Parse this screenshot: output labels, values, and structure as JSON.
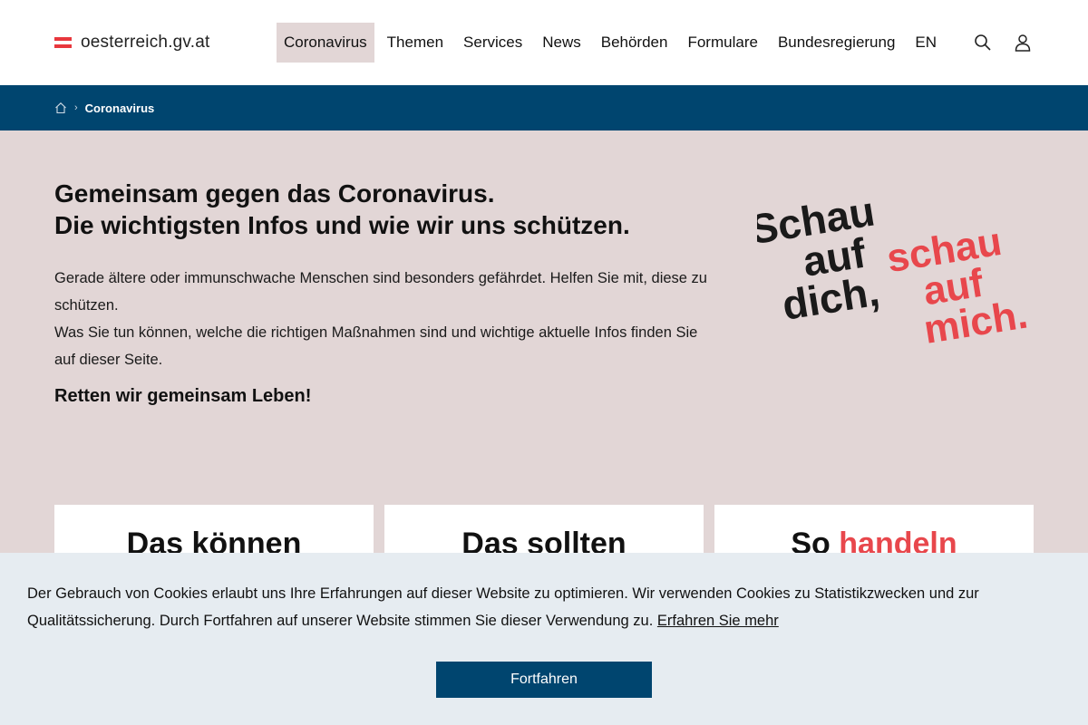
{
  "header": {
    "logo_text": "oesterreich.gv.at",
    "nav": [
      {
        "label": "Coronavirus",
        "active": true
      },
      {
        "label": "Themen"
      },
      {
        "label": "Services"
      },
      {
        "label": "News"
      },
      {
        "label": "Behörden"
      },
      {
        "label": "Formulare"
      },
      {
        "label": "Bundesregierung"
      },
      {
        "label": "EN"
      }
    ],
    "icons": [
      "search-icon",
      "user-icon"
    ]
  },
  "breadcrumb": {
    "home_icon": "home-icon",
    "current": "Coronavirus"
  },
  "hero": {
    "title_line1": "Gemeinsam gegen das Coronavirus.",
    "title_line2": "Die wichtigsten Infos und wie wir uns schützen.",
    "body_line1": "Gerade ältere oder immunschwache Menschen sind besonders gefährdet. Helfen Sie mit, diese zu schützen.",
    "body_line2": "Was Sie tun können, welche die richtigen Maßnahmen sind und wichtige aktuelle Infos finden Sie auf dieser Seite.",
    "strong": "Retten wir gemeinsam Leben!",
    "slogan": {
      "dark_lines": [
        "Schau",
        "auf",
        "dich,"
      ],
      "red_lines": [
        "schau",
        "auf",
        "mich."
      ]
    }
  },
  "cards": [
    {
      "title": "Das können",
      "highlight": ""
    },
    {
      "title": "Das sollten",
      "highlight": ""
    },
    {
      "title": "So ",
      "highlight": "handeln"
    }
  ],
  "cookie": {
    "text": "Der Gebrauch von Cookies erlaubt uns Ihre Erfahrungen auf dieser Website zu optimieren. Wir verwenden Cookies zu Statistikzwecken und zur Qualitätssicherung. Durch Fortfahren auf unserer Website stimmen Sie dieser Verwendung zu.",
    "link": "Erfahren Sie mehr",
    "button": "Fortfahren"
  },
  "colors": {
    "brand_blue": "#00456f",
    "hero_bg": "#e2d6d6",
    "accent_red": "#e8474c",
    "cookie_bg": "#e6ecf1"
  }
}
